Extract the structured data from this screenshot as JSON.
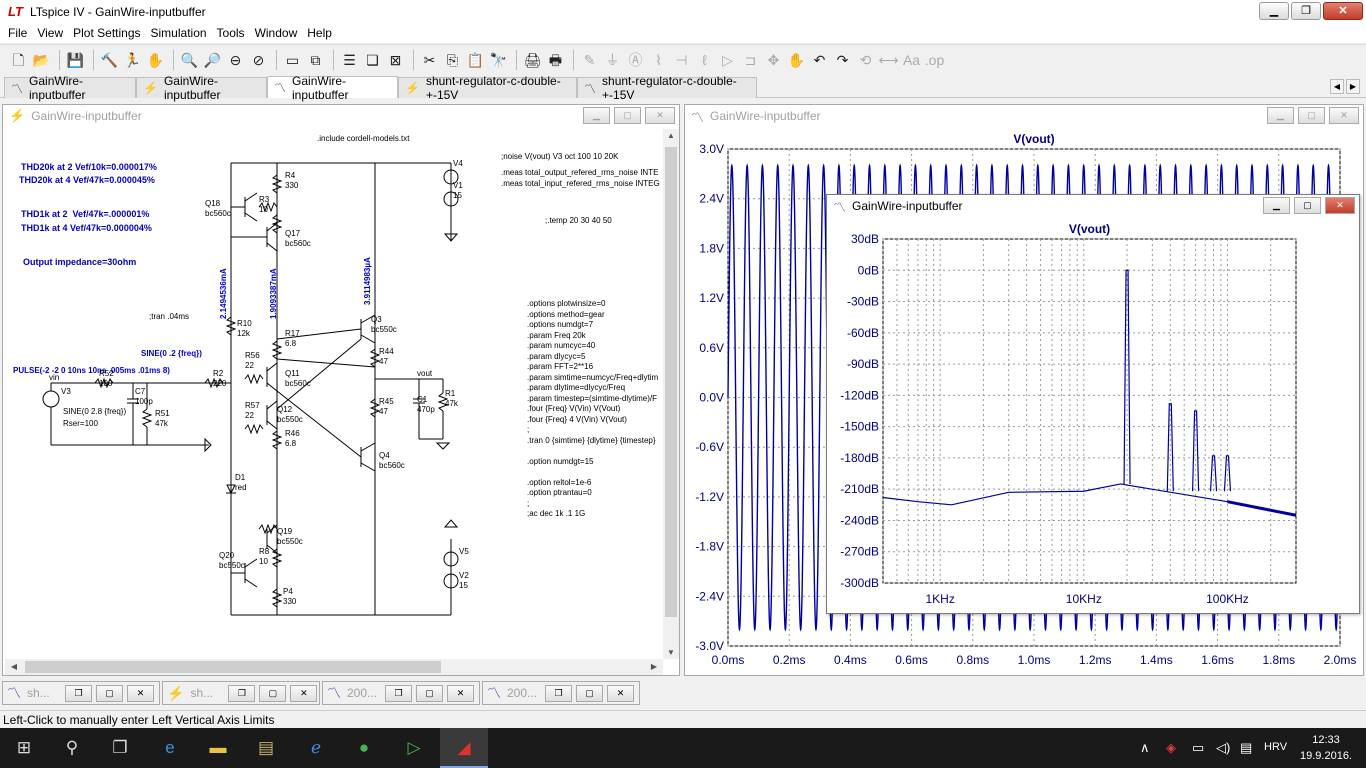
{
  "app": {
    "title": "LTspice IV - GainWire-inputbuffer",
    "logo_glyph": "LT"
  },
  "window_buttons": {
    "minimize": "▁",
    "maximize": "❐",
    "close": "✕"
  },
  "menu": [
    "File",
    "View",
    "Plot Settings",
    "Simulation",
    "Tools",
    "Window",
    "Help"
  ],
  "toolbar_icons": [
    "new-schematic-icon",
    "open-icon",
    "save-icon",
    "control-panel-icon",
    "run-icon",
    "halt-icon",
    "zoom-in-icon",
    "zoom-out-icon",
    "zoom-fit-icon",
    "zoom-cancel-icon",
    "autorange-icon",
    "tile-horizontal-icon",
    "tile-vertical-icon",
    "cascade-icon",
    "close-all-icon",
    "cut-icon",
    "copy-icon",
    "paste-icon",
    "find-icon",
    "print-setup-icon",
    "print-icon",
    "wire-icon",
    "ground-icon",
    "label-icon",
    "resistor-icon",
    "capacitor-icon",
    "inductor-icon",
    "diode-icon",
    "component-icon",
    "move-icon",
    "drag-icon",
    "undo-icon",
    "redo-icon",
    "rotate-icon",
    "mirror-icon",
    "text-icon",
    "spice-directive-icon"
  ],
  "doc_tabs": [
    {
      "label": "GainWire-inputbuffer",
      "type": "waveform",
      "active": false
    },
    {
      "label": "GainWire-inputbuffer",
      "type": "schematic",
      "active": false
    },
    {
      "label": "GainWire-inputbuffer",
      "type": "waveform",
      "active": true
    },
    {
      "label": "shunt-regulator-c-double-+-15V",
      "type": "schematic",
      "active": false
    },
    {
      "label": "shunt-regulator-c-double-+-15V",
      "type": "waveform",
      "active": false
    }
  ],
  "schematic_window": {
    "title": "GainWire-inputbuffer",
    "texts": {
      "include": ".include cordell-models.txt",
      "noise": ";noise V(vout) V3 oct 100 10 20K",
      "meas1": ".meas total_output_refered_rms_noise INTE",
      "meas2": ".meas total_input_refered_rms_noise INTEG",
      "temp": ";.temp 20 30 40 50",
      "thd1": "THD20k at 2 Vef/10k=0.000017%",
      "thd2": "THD20k at 4 Vef/47k=0.000045%",
      "thd3": "THD1k at 2  Vef/47k=.000001%",
      "thd4": "THD1k at 4 Vef/47k=0.000004%",
      "impedance": "Output impedance=30ohm",
      "tran": ";tran .04ms",
      "pulse": "PULSE(-2 -2 0 10ns 10ns .005ms .01ms 8)",
      "sine1": "SINE(0 .2 {freq})",
      "sine2": "SINE(0 2.8 {freq})",
      "rser": "Rser=100",
      "vin": "vin",
      "vout": "vout",
      "cur1": "2.1494536mA",
      "cur2": "1.9093387mA",
      "cur3": "3.9114983µA",
      "options": [
        ".options plotwinsize=0",
        ".options method=gear",
        ".options numdgt=7",
        ".param Freq 20k",
        ".param numcyc=40",
        ".param dlycyc=5",
        ".param FFT=2**16",
        ".param simtime=numcyc/Freq+dlytim",
        ".param dlytime=dlycyc/Freq",
        ".param timestep=(simtime-dlytime)/F",
        ".four {Freq} V(Vin) V(Vout)",
        ".four {Freq} 4 V(Vin) V(Vout)",
        ";",
        ".tran 0 {simtime} {dlytime} {timestep}",
        "",
        ".option numdgt=15",
        "",
        ".option reltol=1e-6",
        ".option ptrantau=0",
        ";",
        ";ac dec 1k .1 1G"
      ],
      "components": [
        {
          "name": "V4",
          "val": ""
        },
        {
          "name": "V1",
          "val": "15"
        },
        {
          "name": "R4",
          "val": "330"
        },
        {
          "name": "R3",
          "val": "10"
        },
        {
          "name": "Q18",
          "val": "bc560c"
        },
        {
          "name": "Q17",
          "val": "bc560c"
        },
        {
          "name": "R10",
          "val": "12k"
        },
        {
          "name": "R17",
          "val": "6.8"
        },
        {
          "name": "Q11",
          "val": "bc560c"
        },
        {
          "name": "R56",
          "val": "22"
        },
        {
          "name": "R57",
          "val": "22"
        },
        {
          "name": "Q12",
          "val": "bc550c"
        },
        {
          "name": "R46",
          "val": "6.8"
        },
        {
          "name": "Q3",
          "val": "bc550c"
        },
        {
          "name": "R44",
          "val": "47"
        },
        {
          "name": "R45",
          "val": "47"
        },
        {
          "name": "Q4",
          "val": "bc560c"
        },
        {
          "name": "R1",
          "val": "47k"
        },
        {
          "name": "C1",
          "val": "470p"
        },
        {
          "name": "R52",
          "val": "100"
        },
        {
          "name": "R2",
          "val": "220"
        },
        {
          "name": "C7",
          "val": "100p"
        },
        {
          "name": "R51",
          "val": "47k"
        },
        {
          "name": "V3",
          "val": ""
        },
        {
          "name": "D1",
          "val": "red"
        },
        {
          "name": "Q19",
          "val": "bc550c"
        },
        {
          "name": "Q20",
          "val": "bc550c"
        },
        {
          "name": "R8",
          "val": "10"
        },
        {
          "name": "P4",
          "val": "330"
        },
        {
          "name": "V5",
          "val": ""
        },
        {
          "name": "V2",
          "val": "15"
        }
      ]
    }
  },
  "time_plot_window": {
    "title": "GainWire-inputbuffer",
    "trace_label": "V(vout)",
    "y_ticks": [
      "3.0V",
      "2.4V",
      "1.8V",
      "1.2V",
      "0.6V",
      "0.0V",
      "-0.6V",
      "-1.2V",
      "-1.8V",
      "-2.4V",
      "-3.0V"
    ],
    "x_ticks": [
      "0.0ms",
      "0.2ms",
      "0.4ms",
      "0.6ms",
      "0.8ms",
      "1.0ms",
      "1.2ms",
      "1.4ms",
      "1.6ms",
      "1.8ms",
      "2.0ms"
    ]
  },
  "fft_plot_window": {
    "title": "GainWire-inputbuffer",
    "trace_label": "V(vout)",
    "y_ticks": [
      "30dB",
      "0dB",
      "-30dB",
      "-60dB",
      "-90dB",
      "-120dB",
      "-150dB",
      "-180dB",
      "-210dB",
      "-240dB",
      "-270dB",
      "-300dB"
    ],
    "x_ticks": [
      "1KHz",
      "10KHz",
      "100KHz"
    ]
  },
  "chart_data": [
    {
      "type": "line",
      "title": "V(vout)",
      "xlabel": "",
      "ylabel": "",
      "xlim": [
        0,
        2.0
      ],
      "ylim": [
        -3.0,
        3.0
      ],
      "x_unit": "ms",
      "y_unit": "V",
      "series": [
        {
          "name": "V(vout)",
          "frequency_khz": 20,
          "amplitude_v": 2.8,
          "color": "#0000a0"
        }
      ],
      "grid": true
    },
    {
      "type": "line",
      "title": "V(vout)",
      "xscale": "log",
      "xlim_hz": [
        400,
        300000
      ],
      "ylim": [
        -300,
        30
      ],
      "y_unit": "dB",
      "series": [
        {
          "name": "V(vout)",
          "color": "#0000a0",
          "peaks": [
            {
              "freq_khz": 20,
              "db": 0
            },
            {
              "freq_khz": 40,
              "db": -128
            },
            {
              "freq_khz": 60,
              "db": -135
            },
            {
              "freq_khz": 80,
              "db": -178
            },
            {
              "freq_khz": 100,
              "db": -178
            }
          ],
          "noise_floor": [
            {
              "freq_khz": 0.4,
              "db": -218
            },
            {
              "freq_khz": 0.7,
              "db": -222
            },
            {
              "freq_khz": 1.2,
              "db": -225
            },
            {
              "freq_khz": 3,
              "db": -213
            },
            {
              "freq_khz": 10,
              "db": -212
            },
            {
              "freq_khz": 18,
              "db": -205
            },
            {
              "freq_khz": 100,
              "db": -222
            },
            {
              "freq_khz": 300,
              "db": -235
            }
          ]
        }
      ],
      "grid": true
    }
  ],
  "minimized_windows": [
    {
      "label": "sh...",
      "type": "waveform"
    },
    {
      "label": "sh...",
      "type": "schematic"
    },
    {
      "label": "200...",
      "type": "waveform"
    },
    {
      "label": "200...",
      "type": "waveform"
    }
  ],
  "status_text": "Left-Click to manually enter Left Vertical Axis Limits",
  "taskbar": {
    "apps": [
      "start-icon",
      "search-icon",
      "task-view-icon",
      "edge-icon",
      "file-explorer-icon",
      "folder-icon",
      "ie-icon",
      "app-green-icon",
      "ltspice-schem-icon",
      "ltspice-icon"
    ],
    "lang": "HRV",
    "time": "12:33",
    "date": "19.9.2016."
  }
}
